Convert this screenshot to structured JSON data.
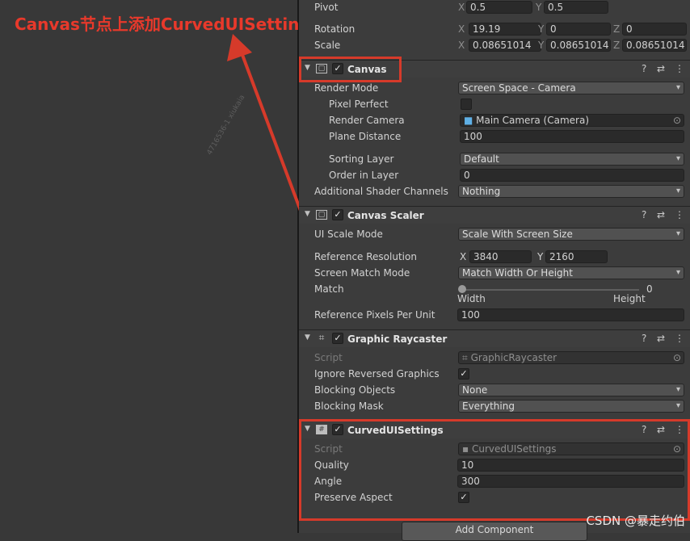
{
  "annotation": {
    "text": "Canvas节点上添加CurvedUISettings"
  },
  "watermark": {
    "text": "4716536-1 xiukaia"
  },
  "footer": {
    "csdn": "CSDN @暴走约伯"
  },
  "transform": {
    "pivot": {
      "label": "Pivot",
      "x": "0.5",
      "y": "0.5"
    },
    "rotation": {
      "label": "Rotation",
      "x": "19.19",
      "y": "0",
      "z": "0"
    },
    "scale": {
      "label": "Scale",
      "x": "0.08651014",
      "y": "0.08651014",
      "z": "0.08651014"
    },
    "axes": {
      "x": "X",
      "y": "Y",
      "z": "Z"
    }
  },
  "canvas": {
    "title": "Canvas",
    "render_mode": {
      "label": "Render Mode",
      "value": "Screen Space - Camera"
    },
    "pixel_perfect": {
      "label": "Pixel Perfect",
      "checked": false
    },
    "render_camera": {
      "label": "Render Camera",
      "value": "Main Camera (Camera)"
    },
    "plane_distance": {
      "label": "Plane Distance",
      "value": "100"
    },
    "sorting_layer": {
      "label": "Sorting Layer",
      "value": "Default"
    },
    "order_in_layer": {
      "label": "Order in Layer",
      "value": "0"
    },
    "shader_channels": {
      "label": "Additional Shader Channels",
      "value": "Nothing"
    }
  },
  "canvas_scaler": {
    "title": "Canvas Scaler",
    "ui_scale_mode": {
      "label": "UI Scale Mode",
      "value": "Scale With Screen Size"
    },
    "reference_resolution": {
      "label": "Reference Resolution",
      "x": "3840",
      "y": "2160"
    },
    "screen_match_mode": {
      "label": "Screen Match Mode",
      "value": "Match Width Or Height"
    },
    "match": {
      "label": "Match",
      "value": "0",
      "level": 0,
      "left": "Width",
      "right": "Height"
    },
    "ref_pixels": {
      "label": "Reference Pixels Per Unit",
      "value": "100"
    }
  },
  "raycaster": {
    "title": "Graphic Raycaster",
    "script": {
      "label": "Script",
      "value": "GraphicRaycaster"
    },
    "ignore_reversed": {
      "label": "Ignore Reversed Graphics",
      "checked": true
    },
    "blocking_objects": {
      "label": "Blocking Objects",
      "value": "None"
    },
    "blocking_mask": {
      "label": "Blocking Mask",
      "value": "Everything"
    }
  },
  "curved": {
    "title": "CurvedUISettings",
    "script": {
      "label": "Script",
      "value": "CurvedUISettings"
    },
    "quality": {
      "label": "Quality",
      "value": "10"
    },
    "angle": {
      "label": "Angle",
      "value": "300"
    },
    "preserve_aspect": {
      "label": "Preserve Aspect",
      "checked": true
    }
  },
  "add_component": {
    "label": "Add Component"
  },
  "icons": {
    "help": "?",
    "settings": "⇄",
    "more": "⋮",
    "check": "✓",
    "dropdown": "▾",
    "fold": "▼",
    "target": "⊙"
  },
  "colors": {
    "highlight": "#d63a2a",
    "annotation": "#e8392b"
  }
}
